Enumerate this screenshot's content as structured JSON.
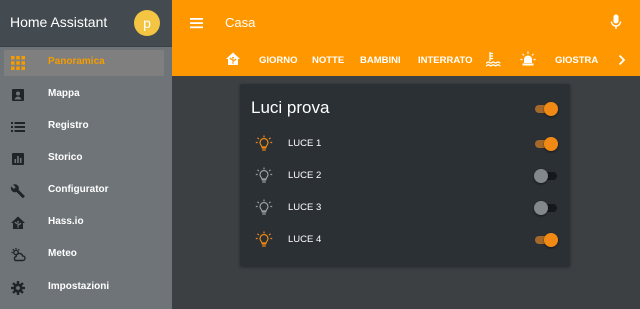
{
  "app": {
    "title": "Home Assistant",
    "avatar_letter": "p"
  },
  "colors": {
    "accent": "#ff9800",
    "active_text": "#f59c00",
    "light_on": "#f08a14",
    "light_off": "#9aa0a4"
  },
  "sidebar": {
    "items": [
      {
        "label": "Panoramica",
        "icon": "grid-icon",
        "active": true
      },
      {
        "label": "Mappa",
        "icon": "map-icon",
        "active": false
      },
      {
        "label": "Registro",
        "icon": "list-icon",
        "active": false
      },
      {
        "label": "Storico",
        "icon": "chart-icon",
        "active": false
      },
      {
        "label": "Configurator",
        "icon": "wrench-icon",
        "active": false
      },
      {
        "label": "Hass.io",
        "icon": "home-assistant-icon",
        "active": false
      },
      {
        "label": "Meteo",
        "icon": "weather-icon",
        "active": false
      },
      {
        "label": "Impostazioni",
        "icon": "gear-icon",
        "active": false
      }
    ]
  },
  "header": {
    "title": "Casa",
    "tabs": [
      {
        "icon": "home-icon"
      },
      {
        "label": "GIORNO"
      },
      {
        "label": "NOTTE"
      },
      {
        "label": "BAMBINI"
      },
      {
        "label": "INTERRATO"
      },
      {
        "icon": "water-level-icon"
      },
      {
        "icon": "siren-icon"
      },
      {
        "label": "GIOSTRA"
      }
    ]
  },
  "card": {
    "title": "Luci prova",
    "master_on": true,
    "lights": [
      {
        "name": "LUCE 1",
        "on": true
      },
      {
        "name": "LUCE 2",
        "on": false
      },
      {
        "name": "LUCE 3",
        "on": false
      },
      {
        "name": "LUCE 4",
        "on": true
      }
    ]
  }
}
